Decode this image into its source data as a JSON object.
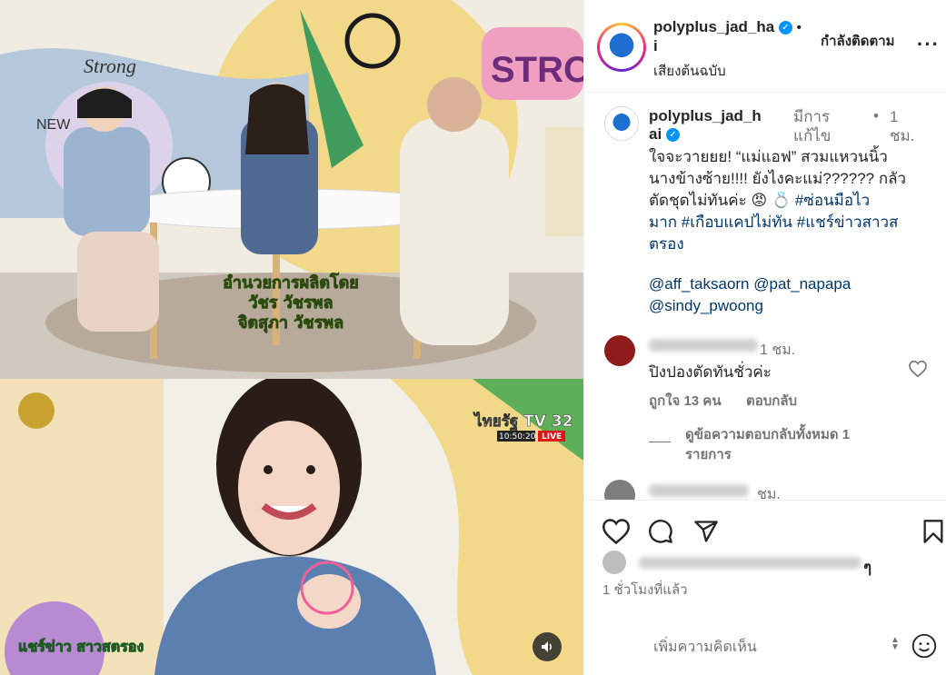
{
  "video": {
    "overlay_credit_lines": [
      "อำนวยการผลิตโดย",
      "วัชร วัชรพล",
      "จิตสุภา วัชรพล"
    ],
    "channel_logo": "ไทยรัฐ TV 32",
    "clock": "10:50:20",
    "live_label": "LIVE",
    "show_logo": "แชร์ข่าว สาวสตรอง",
    "mural_words": [
      "Strong",
      "STRONG",
      "NEW"
    ]
  },
  "header": {
    "username_line1": "polyplus_jad_ha",
    "username_line2": "i",
    "separator": "•",
    "follow_status": "กำลังติดตาม",
    "audio": "เสียงต้นฉบับ",
    "more": "···"
  },
  "caption": {
    "username_line1": "polyplus_jad_h",
    "username_line2": "ai",
    "edited_line1": "มีการ",
    "edited_line2": "แก้ไข",
    "dot": "•",
    "time_line1": "1",
    "time_line2": "ชม.",
    "text_lines": [
      "ใจจะวายยย! “แม่แอฟ” สวมแหวนนิ้ว",
      "นางข้างซ้าย!!!! ยังไงคะแม่?????? กลัว",
      "ตัดชุดไม่ทันค่ะ"
    ],
    "emoji_1": "😡",
    "emoji_2": "💍",
    "hashtag_1": "#ซ่อนมือไว",
    "hashtag_2": "มาก",
    "hashtag_3": "#เกือบแคปไม่ทัน",
    "hashtag_4": "#แชร์ข่าวสาวส",
    "hashtag_5": "ตรอง",
    "mention_1": "@aff_taksaorn",
    "mention_2": "@pat_napapa",
    "mention_3": "@sindy_pwoong"
  },
  "comments": [
    {
      "time": "1 ชม.",
      "text": "ปิงปองตัดทันชั่วค่ะ",
      "likes": "ถูกใจ 13 คน",
      "reply": "ตอบกลับ",
      "view_replies_line1": "ดูข้อความตอบกลับทั้งหมด 1",
      "view_replies_line2": "รายการ"
    },
    {
      "time": "ชม."
    }
  ],
  "footer": {
    "time_ago": "1 ชั่วโมงที่แล้ว",
    "likes_tail": "ๆ",
    "add_comment_placeholder": "เพิ่มความคิดเห็น"
  },
  "icons": {
    "like": "heart-icon",
    "comment": "comment-icon",
    "share": "paper-plane-icon",
    "save": "bookmark-icon",
    "emoji": "smiley-icon",
    "mute": "speaker-icon",
    "verified": "verified-badge-icon"
  },
  "colors": {
    "verified_blue": "#0095f6",
    "link_blue": "#00376b",
    "text": "#262626",
    "muted": "#737373",
    "border": "#efefef",
    "live_red": "#e0141b",
    "brand_blue": "#1f6fd1"
  }
}
